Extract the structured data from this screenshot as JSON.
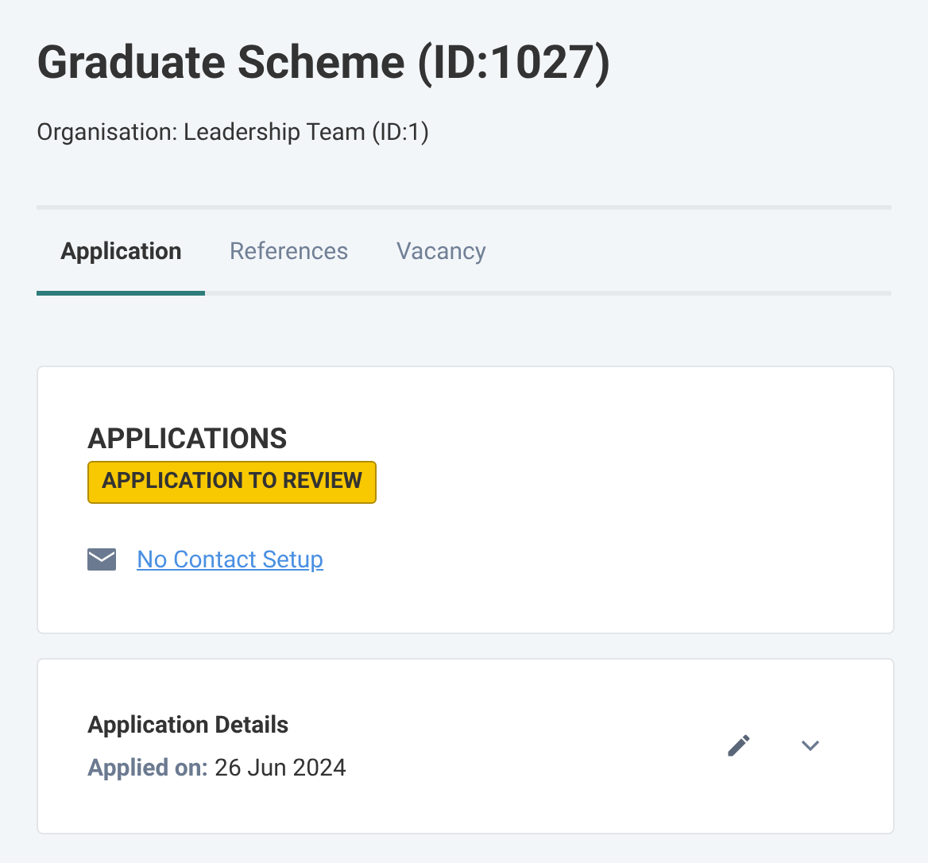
{
  "header": {
    "title": "Graduate Scheme (ID:1027)",
    "subtitle": "Organisation: Leadership Team (ID:1)"
  },
  "tabs": [
    {
      "label": "Application",
      "selected": true
    },
    {
      "label": "References",
      "selected": false
    },
    {
      "label": "Vacancy",
      "selected": false
    }
  ],
  "applications_card": {
    "heading": "APPLICATIONS",
    "status_badge": "APPLICATION TO REVIEW",
    "contact_link": "No Contact Setup"
  },
  "details_card": {
    "title": "Application Details",
    "applied_label": "Applied on:",
    "applied_date": "26 Jun 2024",
    "expanded": false
  }
}
